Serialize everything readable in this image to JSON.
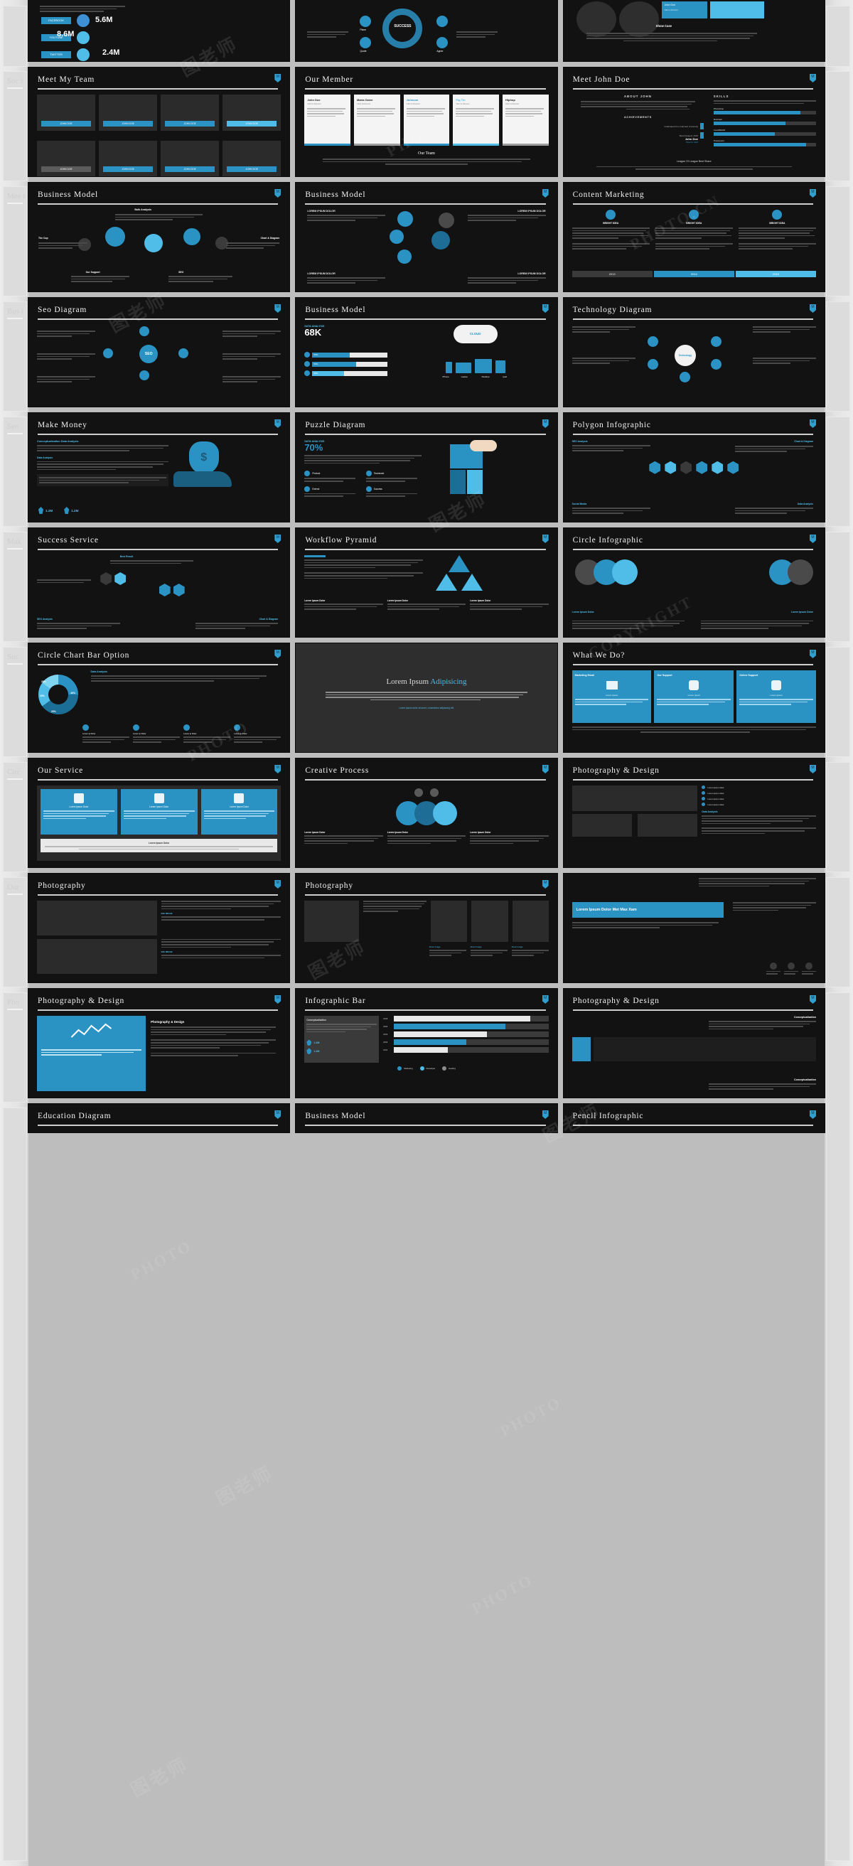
{
  "page": {
    "background_color": "#bdbdbd",
    "slide_background": "#121212",
    "accent_color": "#2b93c4",
    "accent_light": "#4fbde8",
    "title_color": "#f2f2f2"
  },
  "watermarks": [
    {
      "text": "图老师",
      "type": "cn"
    },
    {
      "text": "PHOTO",
      "type": "en"
    },
    {
      "text": "图老师",
      "type": "cn"
    },
    {
      "text": "PHOTO.CN",
      "type": "en"
    },
    {
      "text": "图老师",
      "type": "cn"
    },
    {
      "text": "PHOTO",
      "type": "en"
    },
    {
      "text": "COPYRIGHT",
      "type": "en"
    },
    {
      "text": "图老师",
      "type": "cn"
    },
    {
      "text": "PHOTO",
      "type": "en"
    },
    {
      "text": "图老师",
      "type": "cn"
    }
  ],
  "ghost_sidebar_left": [
    {
      "label": "Soc i"
    },
    {
      "label": "Mee t"
    },
    {
      "label": "Bus i"
    },
    {
      "label": "Seo"
    },
    {
      "label": "Mak"
    },
    {
      "label": "Suc"
    },
    {
      "label": "Circ"
    },
    {
      "label": "Our"
    },
    {
      "label": "Pho"
    }
  ],
  "ghost_sidebar_right": [
    {
      "label": ""
    },
    {
      "label": ""
    },
    {
      "label": ""
    },
    {
      "label": ""
    },
    {
      "label": ""
    },
    {
      "label": ""
    },
    {
      "label": ""
    },
    {
      "label": ""
    },
    {
      "label": ""
    }
  ],
  "slides": [
    {
      "id": 1,
      "title": "",
      "kind": "social-top",
      "badge": ""
    },
    {
      "id": 2,
      "title": "",
      "kind": "success-top",
      "badge": ""
    },
    {
      "id": 3,
      "title": "",
      "kind": "showcase-top",
      "badge": ""
    },
    {
      "id": 4,
      "title": "Meet My Team",
      "kind": "team-cards",
      "badge": "M"
    },
    {
      "id": 5,
      "title": "Our Member",
      "kind": "member-cards",
      "badge": ""
    },
    {
      "id": 6,
      "title": "Meet John Doe",
      "kind": "profile-skills",
      "badge": "M"
    },
    {
      "id": 7,
      "title": "Business Model",
      "kind": "bulb-model",
      "badge": "M"
    },
    {
      "id": 8,
      "title": "Business Model",
      "kind": "circle-model",
      "badge": "M"
    },
    {
      "id": 9,
      "title": "Content Marketing",
      "kind": "timeline",
      "badge": "M"
    },
    {
      "id": 10,
      "title": "Seo Diagram",
      "kind": "seo-diagram",
      "badge": "M"
    },
    {
      "id": 11,
      "title": "Business Model",
      "kind": "cloud-devices",
      "badge": "M"
    },
    {
      "id": 12,
      "title": "Technology Diagram",
      "kind": "tech-diagram",
      "badge": "M"
    },
    {
      "id": 13,
      "title": "Make Money",
      "kind": "money-bag",
      "badge": "M"
    },
    {
      "id": 14,
      "title": "Puzzle Diagram",
      "kind": "puzzle",
      "badge": "M"
    },
    {
      "id": 15,
      "title": "Polygon Infographic",
      "kind": "polygon",
      "badge": "M"
    },
    {
      "id": 16,
      "title": "Success Service",
      "kind": "hex-flow",
      "badge": "M"
    },
    {
      "id": 17,
      "title": "Workflow Pyramid",
      "kind": "pyramid",
      "badge": "M"
    },
    {
      "id": 18,
      "title": "Circle Infographic",
      "kind": "circle-info",
      "badge": "M"
    },
    {
      "id": 19,
      "title": "Circle Chart Bar Option",
      "kind": "donut-chart",
      "badge": "M"
    },
    {
      "id": 20,
      "title": "",
      "kind": "lorem-center",
      "badge": ""
    },
    {
      "id": 21,
      "title": "What We Do?",
      "kind": "what-we-do",
      "badge": "M"
    },
    {
      "id": 22,
      "title": "Our Service",
      "kind": "service-cards",
      "badge": "M"
    },
    {
      "id": 23,
      "title": "Creative Process",
      "kind": "creative-process",
      "badge": "M"
    },
    {
      "id": 24,
      "title": "Photography & Design",
      "kind": "photo-design",
      "badge": "M"
    },
    {
      "id": 25,
      "title": "Photography",
      "kind": "photo-grid-a",
      "badge": "M"
    },
    {
      "id": 26,
      "title": "Photography",
      "kind": "photo-grid-b",
      "badge": "M"
    },
    {
      "id": 27,
      "title": "",
      "kind": "photo-banner",
      "badge": ""
    },
    {
      "id": 28,
      "title": "Photography & Design",
      "kind": "chart-panel",
      "badge": "M"
    },
    {
      "id": 29,
      "title": "Infographic Bar",
      "kind": "infographic-bar",
      "badge": "M"
    },
    {
      "id": 30,
      "title": "Photography & Design",
      "kind": "photo-design-2",
      "badge": "M"
    },
    {
      "id": 31,
      "title": "Education Diagram",
      "kind": "education",
      "badge": "M"
    },
    {
      "id": 32,
      "title": "Business Model",
      "kind": "business-bottom",
      "badge": "M"
    },
    {
      "id": 33,
      "title": "Pencil Infographic",
      "kind": "pencil",
      "badge": "M"
    }
  ],
  "slide_content": {
    "social": {
      "stats": [
        {
          "network": "FACEBOOK",
          "value": "5.6M"
        },
        {
          "network": "YOUTUBE",
          "value": "8.6M"
        },
        {
          "network": "TWITTER",
          "value": "2.4M"
        }
      ]
    },
    "success": {
      "center_label": "SUCCESS",
      "nodes": [
        "Plane",
        "Quote",
        "Agree",
        "Gear"
      ]
    },
    "showcase": {
      "name": "John Doe",
      "role": "CEO & Director",
      "caption": "Show Case"
    },
    "team": {
      "button_label": "JOHN DOE",
      "rows": 2,
      "cols": 4
    },
    "members": {
      "footer_title": "Our Team",
      "cards": [
        {
          "name": "John Doe",
          "role": "CEO & Director"
        },
        {
          "name": "Maria Owen",
          "role": "CEO & Director"
        },
        {
          "name": "Johnson",
          "role": "CEO & Director"
        },
        {
          "name": "Pig Tin",
          "role": "CEO & Director"
        },
        {
          "name": "Hiphop",
          "role": "CEO & Director"
        }
      ]
    },
    "profile": {
      "heading": "ABOUT JOHN",
      "section_a": "ACHIEVEMENTS",
      "achievement": "Graduated From Harvard University",
      "best_designer": "Best Designer 2015",
      "name": "John Doe",
      "role": "Director CEO",
      "skills_title": "SKILLS",
      "skills": [
        {
          "label": "Photoshop",
          "value": 85
        },
        {
          "label": "Illustrator",
          "value": 70
        },
        {
          "label": "CorelDRAW",
          "value": 60
        },
        {
          "label": "Powerpoint",
          "value": 90
        }
      ],
      "footer": "League Of League Best Share"
    },
    "bulb_model": {
      "labels": [
        "Bulb Analysis",
        "The Cup",
        "Chart & Diagram",
        "Our Support",
        "SEO"
      ]
    },
    "circle_model": {
      "labels": [
        "LOREM IPSUM DOLOR",
        "LOREM IPSUM DOLOR",
        "LOREM IPSUM DOLOR",
        "LOREM IPSUM DOLOR"
      ]
    },
    "content_marketing": {
      "columns": [
        "BRIGHT IDEA",
        "BRIGHT IDEA",
        "BRIGHT IDEA"
      ],
      "years": [
        "2013",
        "2014",
        "2015"
      ]
    },
    "seo_diagram": {
      "center_label": "SEO"
    },
    "cloud_model": {
      "data_title": "DATA ANALYSIS",
      "data_value": "68K",
      "cloud_label": "CLOUD",
      "bars": [
        {
          "value": "50%"
        },
        {
          "value": "50%"
        },
        {
          "value": "50%"
        }
      ],
      "devices": [
        "iPhone",
        "Laptop",
        "Desktop",
        "Ipad"
      ]
    },
    "technology": {
      "center_label": "Technology"
    },
    "make_money": {
      "heading": "Conceptualization Data Analysis",
      "sub": "Data Analysis",
      "stats": [
        {
          "value": "1.2M"
        },
        {
          "value": "1.2M"
        }
      ]
    },
    "puzzle": {
      "data_title": "DATA ANALYSIS",
      "data_value": "70%",
      "items": [
        "Product",
        "Teamwork",
        "Extend",
        "Success"
      ]
    },
    "polygon": {
      "left_title": "SEO Analysis",
      "right_title": "Chart & Diagram",
      "bottom_left": "Social Media",
      "bottom_right": "Data Analysis"
    },
    "success_service": {
      "label_top": "Best Result",
      "label_bl": "SEO Analysis",
      "label_br": "Chart & Diagram"
    },
    "pyramid": {
      "items": [
        "Lorem Ipsum Dolor",
        "Lorem Ipsum Dolor",
        "Lorem Ipsum Dolor"
      ]
    },
    "circle_info": {
      "labels": [
        "Lorem Ipsum Dolor",
        "Lorem Ipsum Dolor"
      ]
    },
    "donut": {
      "title": "Data Analysis",
      "segments": [
        {
          "label": "25%",
          "value": 25
        },
        {
          "label": "40%",
          "value": 40
        },
        {
          "label": "20%",
          "value": 20
        },
        {
          "label": "15%",
          "value": 15
        }
      ],
      "legend": [
        "Lorem ip Dolor",
        "Lorem ip Dolor",
        "Lorem ip Dolor",
        "Lorem ip Dolor"
      ]
    },
    "lorem_center": {
      "title_a": "Lorem Ipsum",
      "title_b": "Adipisicing",
      "link": "Lorem ipsum dolor sit amet, consectetur adipiscing elit."
    },
    "what_we_do": {
      "cards": [
        {
          "title": "Marketing Email",
          "sub": "Lorem Ipsum"
        },
        {
          "title": "Our Support",
          "sub": "Lorem Ipsum"
        },
        {
          "title": "Online Support",
          "sub": "Lorem Ipsum"
        }
      ]
    },
    "our_service": {
      "cards": [
        {
          "title": "Lorem Ipsum Dolor"
        },
        {
          "title": "Lorem Ipsum Dolor"
        },
        {
          "title": "Lorem Ipsum Dolor"
        }
      ],
      "footer": "Lorem Ipsum Dolor"
    },
    "creative_process": {
      "items": [
        "Lorem Ipsum Dolor",
        "Lorem Ipsum Dolor",
        "Lorem Ipsum Dolor"
      ]
    },
    "photo_design": {
      "bullets": [
        "Lorem ipsum dolor",
        "Lorem ipsum dolor",
        "Lorem ipsum dolor",
        "Lorem ipsum dolor"
      ],
      "sub_title": "Data Analysis"
    },
    "photography_a": {
      "captions": [
        "BIG IMAGE",
        "BIG IMAGE"
      ]
    },
    "photography_b": {
      "captions": [
        "About Image",
        "About Image",
        "About Image"
      ]
    },
    "photo_banner": {
      "headline": "Lorem Ipsum Dolor Met Max Xam"
    },
    "infographic_bar": {
      "title": "Conceptualization",
      "years": [
        "2015",
        "2014",
        "2013",
        "2012",
        "2011"
      ],
      "values": [
        88,
        72,
        60,
        47,
        35
      ],
      "legend": [
        "Marketing",
        "Developer",
        "Hosting"
      ],
      "stats": [
        {
          "value": "1.2M"
        },
        {
          "value": "1.2M"
        }
      ]
    },
    "photo_design_2": {
      "title_a": "Conceptualization",
      "title_b": "Conceptualization"
    }
  }
}
